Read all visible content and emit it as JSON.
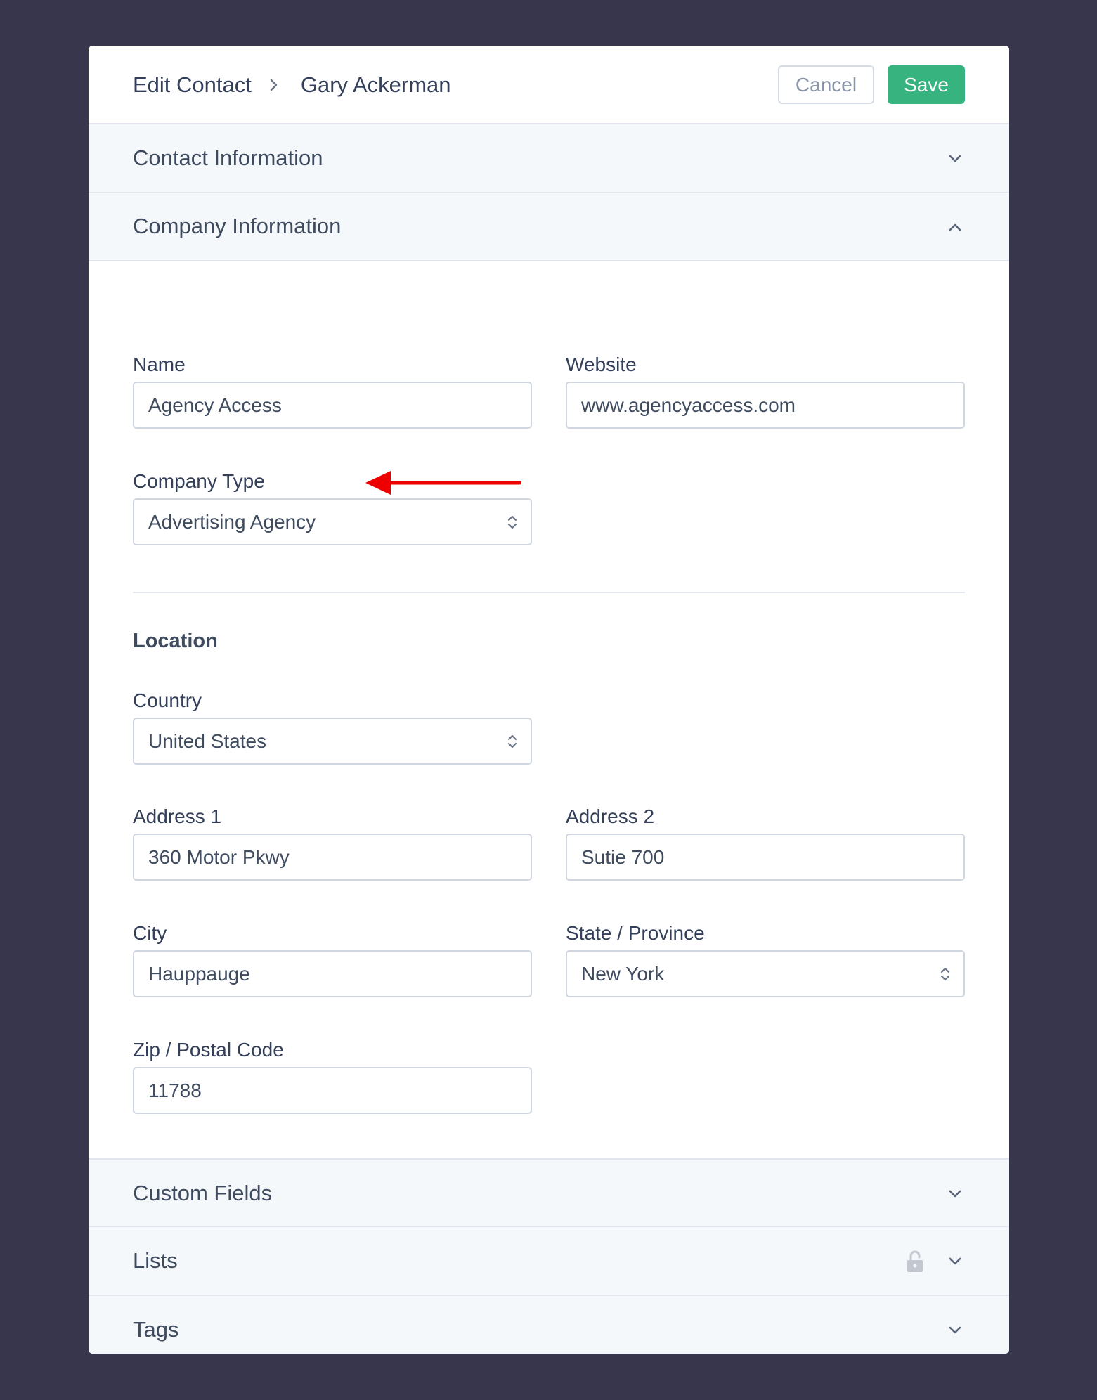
{
  "header": {
    "breadcrumb_root": "Edit Contact",
    "breadcrumb_current": "Gary Ackerman",
    "cancel_label": "Cancel",
    "save_label": "Save"
  },
  "sections": {
    "contact_information": "Contact Information",
    "company_information": "Company Information",
    "custom_fields": "Custom Fields",
    "lists": "Lists",
    "tags": "Tags"
  },
  "company": {
    "name_label": "Name",
    "name_value": "Agency Access",
    "website_label": "Website",
    "website_value": "www.agencyaccess.com",
    "type_label": "Company Type",
    "type_value": "Advertising Agency"
  },
  "location": {
    "heading": "Location",
    "country_label": "Country",
    "country_value": "United States",
    "address1_label": "Address 1",
    "address1_value": "360 Motor Pkwy",
    "address2_label": "Address 2",
    "address2_value": "Sutie 700",
    "city_label": "City",
    "city_value": "Hauppauge",
    "state_label": "State / Province",
    "state_value": "New York",
    "zip_label": "Zip / Postal Code",
    "zip_value": "11788"
  },
  "icons": {
    "breadcrumb_separator": "chevron-right-icon",
    "collapsed": "chevron-down-icon",
    "expanded": "chevron-up-icon",
    "select": "updown-icon",
    "locked": "lock-icon",
    "annotation": "red-arrow-icon"
  },
  "colors": {
    "background": "#38364d",
    "save_button": "#36b37e",
    "annotation_arrow": "#ee0000",
    "section_header_bg": "#f5f8fb"
  }
}
